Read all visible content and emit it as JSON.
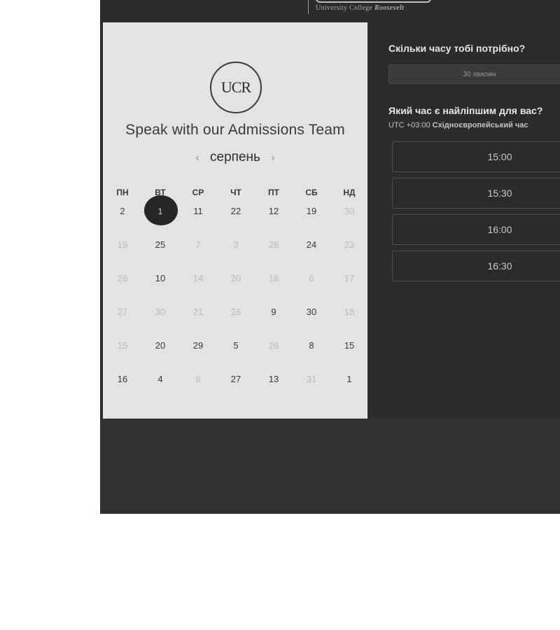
{
  "header": {
    "brand_sub_prefix": "University College ",
    "brand_sub_italic": "Roosevelt"
  },
  "left": {
    "logo_text": "UCR",
    "title": "Speak with our Admissions Team",
    "month": "серпень",
    "prev_icon": "chevron-left-icon",
    "next_icon": "chevron-right-icon",
    "prev_glyph": "‹",
    "next_glyph": "›",
    "weekdays": [
      "ПН",
      "ВТ",
      "СР",
      "ЧТ",
      "ПТ",
      "СБ",
      "НД"
    ],
    "days": [
      [
        "2",
        "1",
        "11",
        "22",
        "12",
        "19",
        "30"
      ],
      [
        "19",
        "25",
        "7",
        "3",
        "28",
        "24",
        "23"
      ],
      [
        "26",
        "10",
        "14",
        "20",
        "18",
        "6",
        "17"
      ],
      [
        "27",
        "30",
        "21",
        "28",
        "9",
        "30",
        "18"
      ],
      [
        "15",
        "20",
        "29",
        "5",
        "26",
        "8",
        "15"
      ],
      [
        "16",
        "4",
        "6",
        "27",
        "13",
        "31",
        "1"
      ]
    ],
    "muted": [
      [
        false,
        false,
        false,
        false,
        false,
        false,
        true
      ],
      [
        true,
        false,
        true,
        true,
        true,
        false,
        true
      ],
      [
        true,
        false,
        true,
        true,
        true,
        true,
        true
      ],
      [
        true,
        true,
        true,
        true,
        false,
        false,
        true
      ],
      [
        true,
        false,
        false,
        false,
        true,
        false,
        false
      ],
      [
        false,
        false,
        true,
        false,
        false,
        true,
        false
      ]
    ],
    "selected_day": "1"
  },
  "right": {
    "duration_question": "Скільки часу тобі потрібно?",
    "duration_value": "30 хвилин",
    "time_question": "Який час є найліпшим для вас?",
    "timezone_prefix": "UTC +03:00 ",
    "timezone_name": "Східноєвропейський час",
    "slots": [
      "15:00",
      "15:30",
      "16:00",
      "16:30"
    ]
  },
  "colors": {
    "frame_bg": "#2b2b2b",
    "calendar_bg": "#e3e3e3",
    "selected_bg": "#262626"
  }
}
